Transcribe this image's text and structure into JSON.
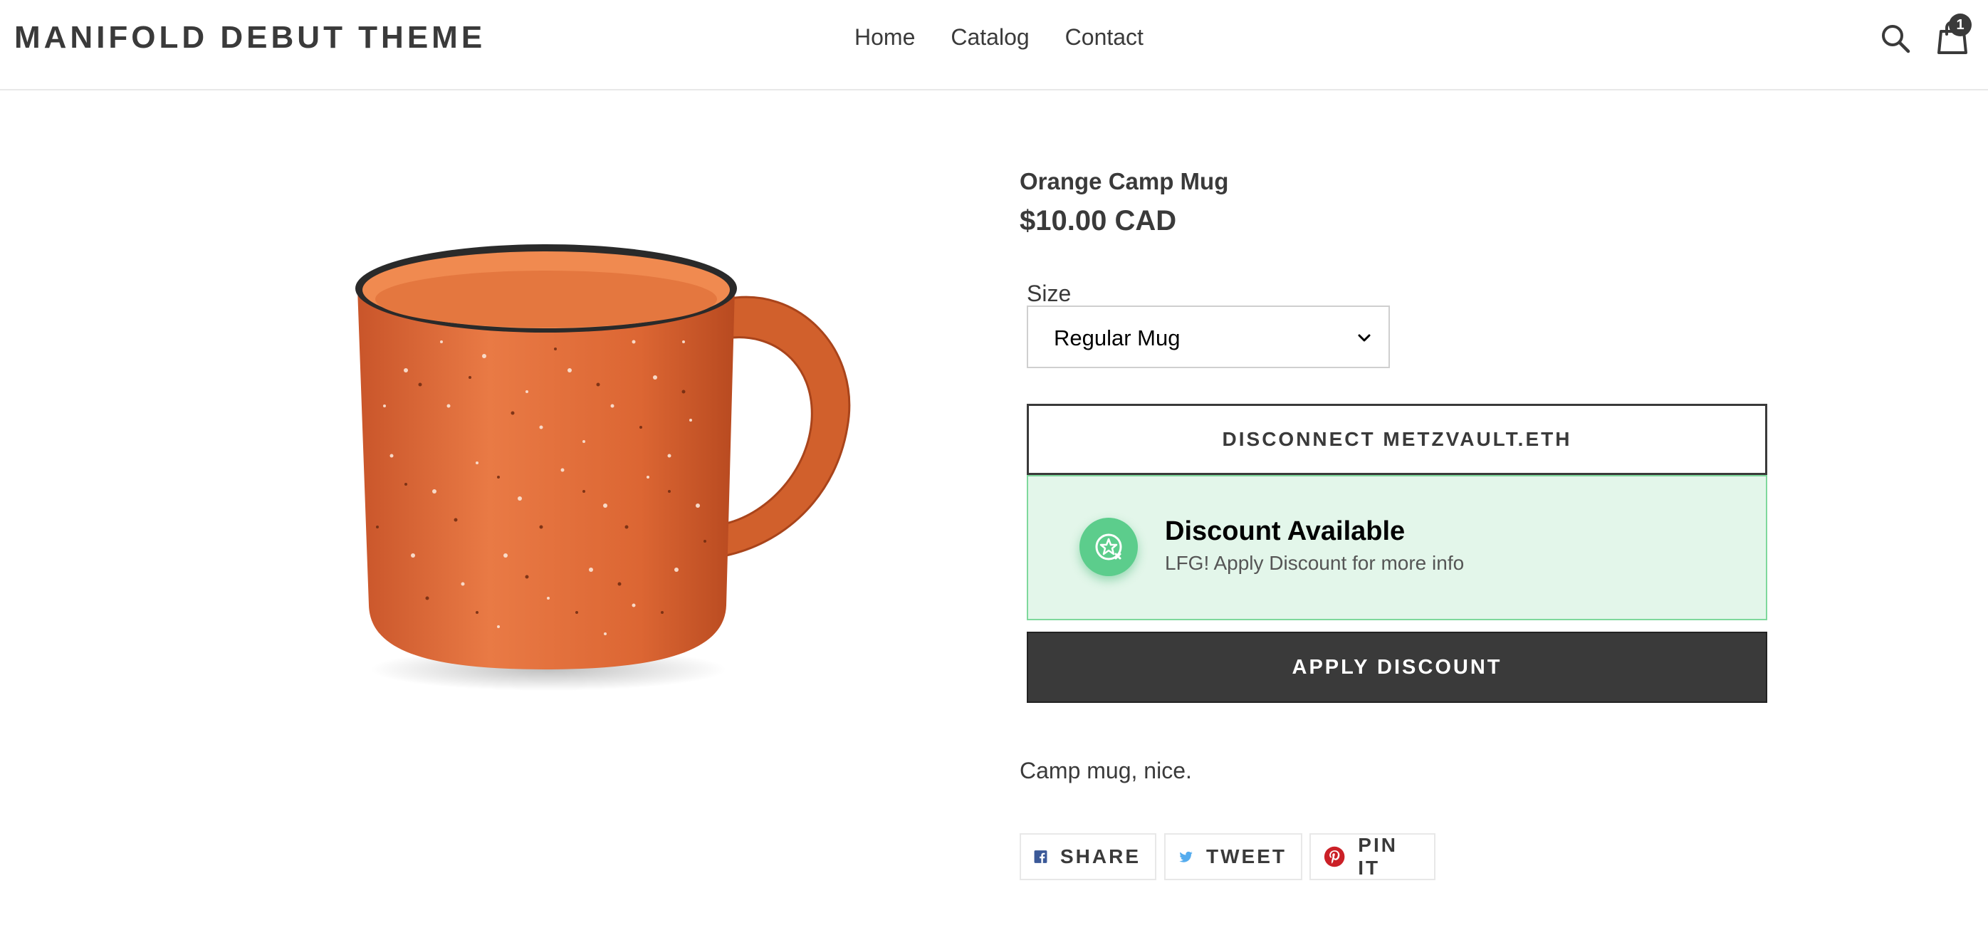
{
  "header": {
    "logo": "MANIFOLD DEBUT THEME",
    "nav": [
      "Home",
      "Catalog",
      "Contact"
    ],
    "cart_count": "1",
    "icons": [
      "search-icon",
      "cart-icon"
    ]
  },
  "product": {
    "title": "Orange Camp Mug",
    "price": "$10.00 CAD",
    "size_label": "Size",
    "size_value": "Regular Mug",
    "description": "Camp mug, nice."
  },
  "wallet": {
    "disconnect_label": "DISCONNECT METZVAULT.ETH"
  },
  "discount": {
    "title": "Discount Available",
    "subtitle": "LFG! Apply Discount for more info",
    "apply_label": "APPLY DISCOUNT",
    "accent": "#5ccd8c",
    "background": "#e3f6ea"
  },
  "share": {
    "facebook": "SHARE",
    "twitter": "TWEET",
    "pinterest": "PIN IT"
  },
  "colors": {
    "text": "#3a3a3a",
    "facebook": "#3b5998",
    "twitter": "#55acee",
    "pinterest": "#cb2027"
  }
}
